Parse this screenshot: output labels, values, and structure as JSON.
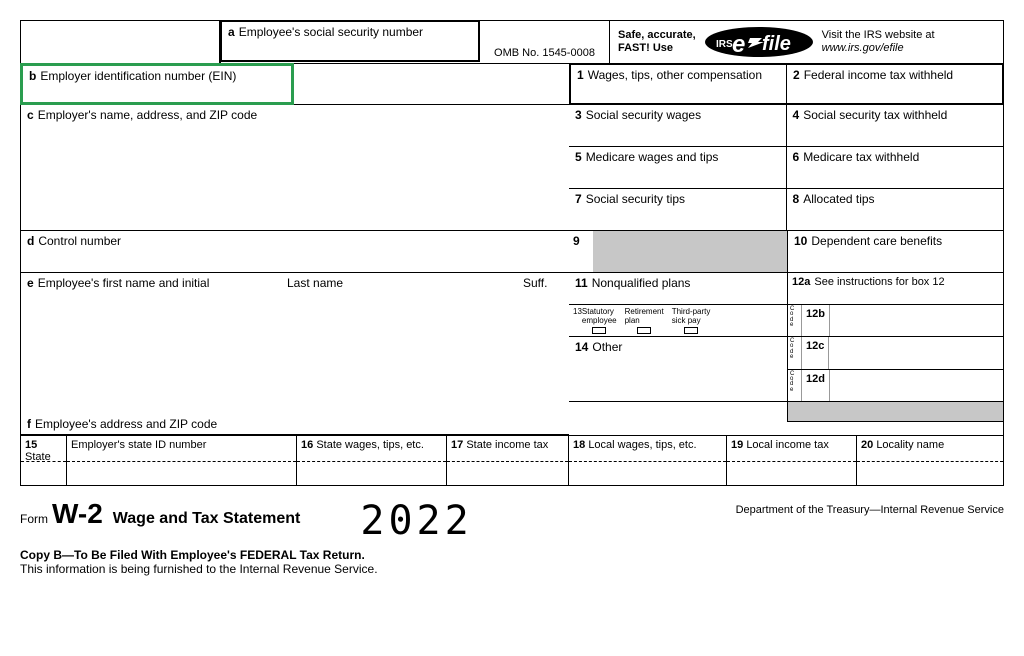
{
  "boxes": {
    "a": "Employee's social security number",
    "omb": "OMB No. 1545-0008",
    "efile_safe": "Safe, accurate,",
    "efile_fast": "FAST! Use",
    "efile_visit": "Visit the IRS website at",
    "efile_url": "www.irs.gov/efile",
    "b": "Employer identification number (EIN)",
    "c": "Employer's name, address, and ZIP code",
    "d": "Control number",
    "e_fn": "Employee's first name and initial",
    "e_ln": "Last name",
    "e_suff": "Suff.",
    "f": "Employee's address and ZIP code",
    "1": "Wages, tips, other compensation",
    "2": "Federal income tax withheld",
    "3": "Social security wages",
    "4": "Social security tax withheld",
    "5": "Medicare wages and tips",
    "6": "Medicare tax withheld",
    "7": "Social security tips",
    "8": "Allocated tips",
    "9": "9",
    "10": "Dependent care benefits",
    "11": "Nonqualified plans",
    "12a": "See instructions for box 12",
    "12b": "12b",
    "12c": "12c",
    "12d": "12d",
    "13_num": "13",
    "13_stat": "Statutory\nemployee",
    "13_ret": "Retirement\nplan",
    "13_sick": "Third-party\nsick pay",
    "14": "Other",
    "15": "State",
    "15b": "Employer's state ID number",
    "16": "State wages, tips, etc.",
    "17": "State income tax",
    "18": "Local wages, tips, etc.",
    "19": "Local income tax",
    "20": "Locality name",
    "code": "C\no\nd\ne"
  },
  "footer": {
    "form": "Form",
    "w2": "W-2",
    "title": "Wage and Tax Statement",
    "year": "2022",
    "dept": "Department of the Treasury—Internal Revenue Service",
    "copyb": "Copy B—To Be Filed With Employee's FEDERAL Tax Return.",
    "furnish": "This information is being furnished to the Internal Revenue Service."
  }
}
